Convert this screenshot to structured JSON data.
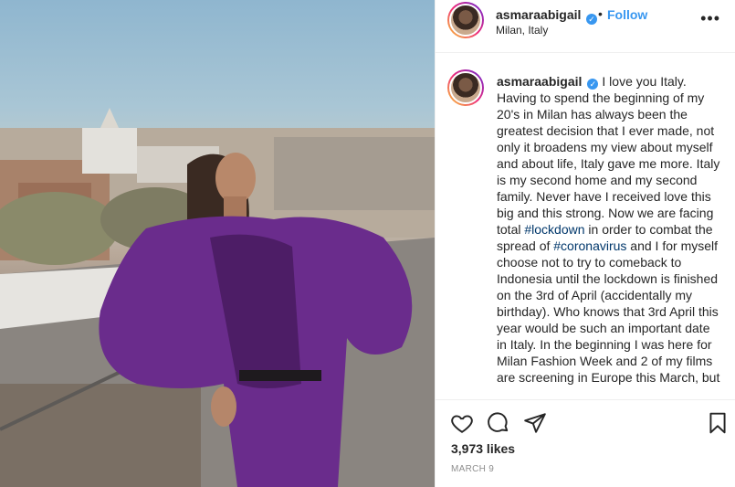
{
  "post": {
    "username": "asmaraabigail",
    "verified_icon": "verified-badge-icon",
    "separator": "•",
    "follow_label": "Follow",
    "location": "Milan, Italy",
    "more_icon": "more-options-icon"
  },
  "caption": {
    "username": "asmaraabigail",
    "text_1": "I love you Italy. Having to spend the beginning of my 20's in Milan has always been the greatest decision that I ever made, not only it broadens my view about myself and about life, Italy gave me more. Italy is my second home and my second family. Never have I received love this big and this strong. Now we are facing total ",
    "hashtag_1": "#lockdown",
    "text_2": " in order to combat the spread of ",
    "hashtag_2": "#coronavirus",
    "text_3": " and I for myself choose not to try to comeback to Indonesia until the lockdown is finished on the 3rd of April (accidentally my birthday). Who knows that 3rd April this year would be such an important date in Italy. In the beginning I was here for Milan Fashion Week and 2 of my films are screening in Europe this March, but"
  },
  "actions": {
    "like_icon": "heart-icon",
    "comment_icon": "comment-icon",
    "share_icon": "share-icon",
    "save_icon": "bookmark-icon"
  },
  "likes": "3,973 likes",
  "date": "MARCH 9",
  "colors": {
    "accent": "#3897f0",
    "hashtag": "#00376b",
    "text": "#262626",
    "muted": "#8e8e8e",
    "dress": "#6a2c8c"
  }
}
